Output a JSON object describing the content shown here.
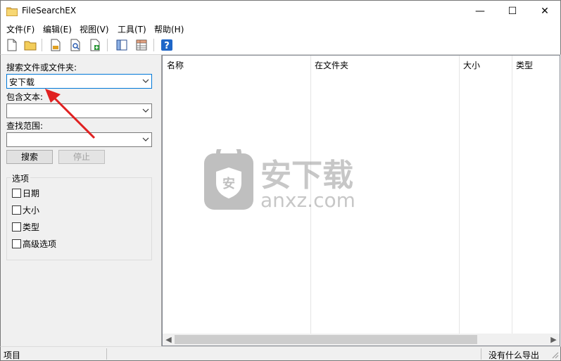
{
  "window": {
    "title": "FileSearchEX",
    "minimize_glyph": "—",
    "maximize_glyph": "☐",
    "close_glyph": "✕"
  },
  "menu": [
    {
      "label": "文件(F)"
    },
    {
      "label": "编辑(E)"
    },
    {
      "label": "视图(V)"
    },
    {
      "label": "工具(T)"
    },
    {
      "label": "帮助(H)"
    }
  ],
  "toolbar": {
    "icons": [
      "new-file-icon",
      "open-folder-icon",
      "save-icon",
      "find-icon",
      "export-icon",
      "panel-layout-icon",
      "grid-view-icon",
      "help-icon"
    ]
  },
  "search": {
    "name_label": "搜索文件或文件夹:",
    "name_value": "安下载",
    "text_label": "包含文本:",
    "text_value": "",
    "scope_label": "查找范围:",
    "scope_value": "",
    "search_button": "搜索",
    "stop_button": "停止"
  },
  "options": {
    "title": "选项",
    "items": [
      {
        "label": "日期",
        "checked": false
      },
      {
        "label": "大小",
        "checked": false
      },
      {
        "label": "类型",
        "checked": false
      },
      {
        "label": "高级选项",
        "checked": false
      }
    ]
  },
  "results": {
    "columns": [
      {
        "label": "名称"
      },
      {
        "label": "在文件夹"
      },
      {
        "label": "大小"
      },
      {
        "label": "类型"
      }
    ],
    "rows": []
  },
  "watermark": {
    "cn_text": "安下载",
    "en_text": "anxz.com"
  },
  "status": {
    "left": "项目",
    "right": "没有什么导出"
  },
  "colors": {
    "accent": "#0078d7",
    "annotation_arrow": "#e02020",
    "watermark_gray": "#9a9a9a"
  }
}
